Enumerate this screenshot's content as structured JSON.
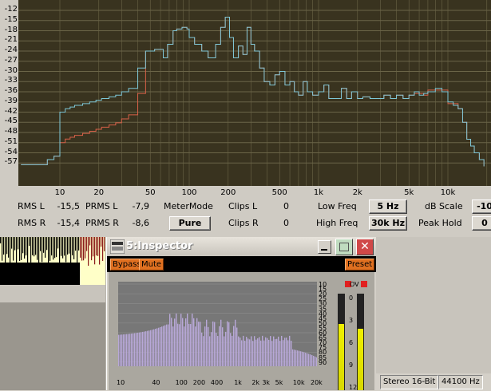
{
  "analyzer": {
    "y_ticks": [
      "-12",
      "-15",
      "-18",
      "-21",
      "-24",
      "-27",
      "-30",
      "-33",
      "-36",
      "-39",
      "-42",
      "-45",
      "-48",
      "-51",
      "-54",
      "-57"
    ],
    "x_ticks": [
      "10",
      "20",
      "50",
      "100",
      "200",
      "500",
      "1k",
      "2k",
      "5k",
      "10k"
    ],
    "rms_l_label": "RMS  L",
    "rms_l_value": "-15,5",
    "rms_r_label": "RMS  R",
    "rms_r_value": "-15,4",
    "prms_l_label": "PRMS  L",
    "prms_l_value": "-7,9",
    "prms_r_label": "PRMS  R",
    "prms_r_value": "-8,6",
    "meter_mode_label": "MeterMode",
    "meter_mode_value": "Pure",
    "clips_l_label": "Clips  L",
    "clips_l_value": "0",
    "clips_r_label": "Clips  R",
    "clips_r_value": "0",
    "low_freq_label": "Low  Freq",
    "low_freq_value": "5 Hz",
    "high_freq_label": "High  Freq",
    "high_freq_value": "30k Hz",
    "db_scale_label": "dB  Scale",
    "db_scale_value": "-10",
    "peak_hold_label": "Peak  Hold",
    "peak_hold_value": "0",
    "colors": {
      "plot_bg": "#39331f",
      "grid": "#6b6548",
      "line_l": "#7ec8d8",
      "line_r": "#d86048"
    }
  },
  "inspector": {
    "title": "5:Inspector",
    "bypass_label": "Bypass",
    "mute_label": "Mute",
    "preset_label": "Preset",
    "db_ticks": [
      "10",
      "15",
      "20",
      "25",
      "30",
      "35",
      "40",
      "45",
      "50",
      "55",
      "60",
      "65",
      "70",
      "75",
      "80",
      "85",
      "90"
    ],
    "freq_ticks": [
      "10",
      "40",
      "100",
      "200",
      "400",
      "1k",
      "2k",
      "3k",
      "5k",
      "10k",
      "20k"
    ],
    "meter_ov_label": "OV",
    "meter_ticks": [
      "0",
      "3",
      "6",
      "9",
      "12"
    ],
    "meter_value_left": 0.7,
    "meter_value_right": 0.65
  },
  "statusbar": {
    "format": "Stereo 16-Bit",
    "rate": "44100 Hz"
  }
}
